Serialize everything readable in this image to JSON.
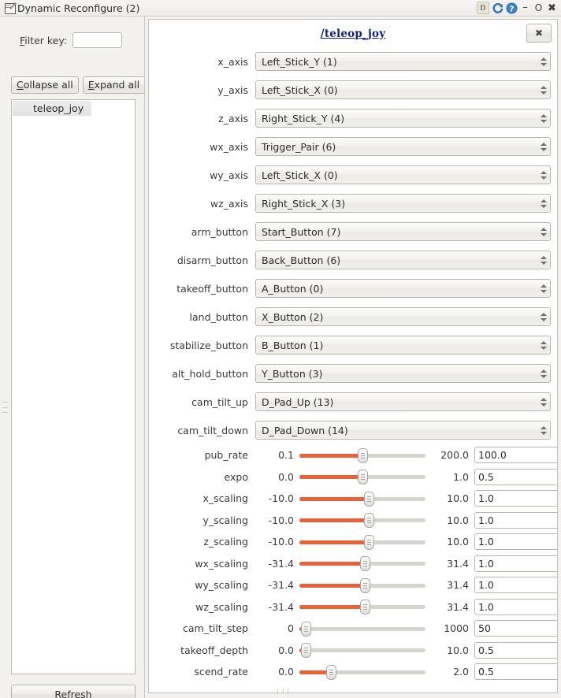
{
  "window": {
    "title": "Dynamic Reconfigure (2)",
    "icon": "notepad-pencil-icon",
    "dock_label": "D",
    "reload_icon": "reload-icon",
    "help_icon": "help-icon",
    "minimize_label": "–",
    "maximize_label": "O",
    "close_label": "✖"
  },
  "sidebar": {
    "filter_label_pre": "F",
    "filter_label_post": "ilter key:",
    "filter_value": "",
    "filter_placeholder": "",
    "collapse_pre": "C",
    "collapse_post": "ollapse all",
    "expand_pre": "E",
    "expand_post": "xpand all",
    "tree_items": [
      {
        "label": "teleop_joy",
        "selected": true
      }
    ],
    "refresh_pre": "R",
    "refresh_post": "efresh"
  },
  "panel": {
    "group_title": "/teleop_joy",
    "close_label": "✖",
    "combo_rows": [
      {
        "label": "x_axis",
        "value": "Left_Stick_Y (1)"
      },
      {
        "label": "y_axis",
        "value": "Left_Stick_X (0)"
      },
      {
        "label": "z_axis",
        "value": "Right_Stick_Y (4)"
      },
      {
        "label": "wx_axis",
        "value": "Trigger_Pair (6)"
      },
      {
        "label": "wy_axis",
        "value": "Left_Stick_X (0)"
      },
      {
        "label": "wz_axis",
        "value": "Right_Stick_X (3)"
      },
      {
        "label": "arm_button",
        "value": "Start_Button (7)"
      },
      {
        "label": "disarm_button",
        "value": "Back_Button (6)"
      },
      {
        "label": "takeoff_button",
        "value": "A_Button (0)"
      },
      {
        "label": "land_button",
        "value": "X_Button (2)"
      },
      {
        "label": "stabilize_button",
        "value": "B_Button (1)"
      },
      {
        "label": "alt_hold_button",
        "value": "Y_Button (3)"
      },
      {
        "label": "cam_tilt_up",
        "value": "D_Pad_Up (13)"
      },
      {
        "label": "cam_tilt_down",
        "value": "D_Pad_Down (14)"
      }
    ],
    "slider_rows": [
      {
        "label": "pub_rate",
        "min": "0.1",
        "max": "200.0",
        "value": "100.0",
        "pct": 50
      },
      {
        "label": "expo",
        "min": "0.0",
        "max": "1.0",
        "value": "0.5",
        "pct": 50
      },
      {
        "label": "x_scaling",
        "min": "-10.0",
        "max": "10.0",
        "value": "1.0",
        "pct": 55
      },
      {
        "label": "y_scaling",
        "min": "-10.0",
        "max": "10.0",
        "value": "1.0",
        "pct": 55
      },
      {
        "label": "z_scaling",
        "min": "-10.0",
        "max": "10.0",
        "value": "1.0",
        "pct": 55
      },
      {
        "label": "wx_scaling",
        "min": "-31.4",
        "max": "31.4",
        "value": "1.0",
        "pct": 52
      },
      {
        "label": "wy_scaling",
        "min": "-31.4",
        "max": "31.4",
        "value": "1.0",
        "pct": 52
      },
      {
        "label": "wz_scaling",
        "min": "-31.4",
        "max": "31.4",
        "value": "1.0",
        "pct": 52
      },
      {
        "label": "cam_tilt_step",
        "min": "0",
        "max": "1000",
        "value": "50",
        "pct": 5
      },
      {
        "label": "takeoff_depth",
        "min": "0.0",
        "max": "10.0",
        "value": "0.5",
        "pct": 5
      },
      {
        "label": "scend_rate",
        "min": "0.0",
        "max": "2.0",
        "value": "0.5",
        "pct": 25
      }
    ]
  },
  "colors": {
    "slider_fill": "#e7633a",
    "slider_track": "#d6d4d1",
    "link": "#14227a",
    "window_bg": "#f2f1f0"
  }
}
